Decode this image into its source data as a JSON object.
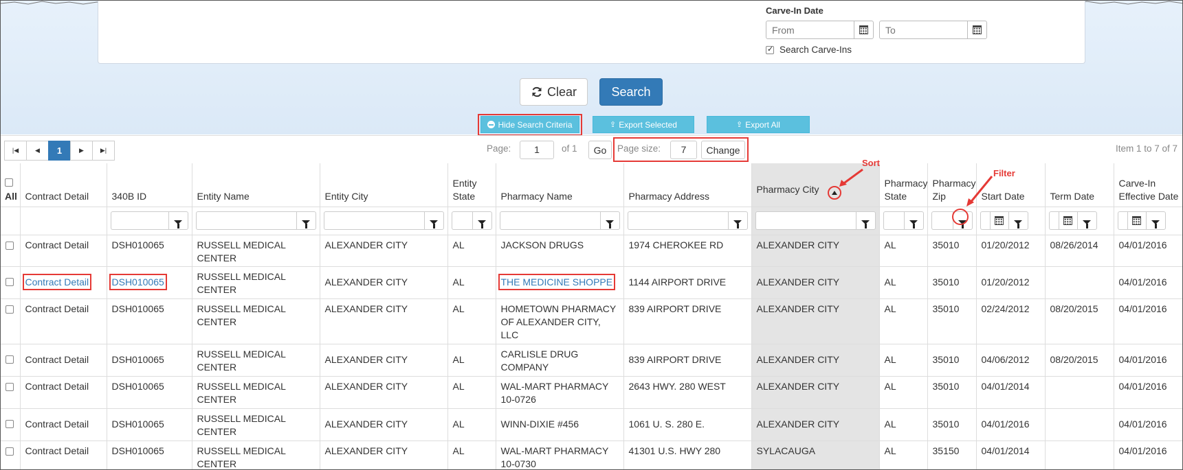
{
  "carve_in": {
    "label": "Carve-In Date",
    "from_placeholder": "From",
    "to_placeholder": "To",
    "search_carve_ins_label": "Search Carve-Ins",
    "search_carve_ins_checked": true
  },
  "buttons": {
    "clear": "Clear",
    "search": "Search",
    "hide_criteria": "Hide Search Criteria",
    "export_selected": "Export Selected",
    "export_all": "Export All"
  },
  "pager": {
    "page_label": "Page:",
    "page_value": "1",
    "of_text": "of 1",
    "go": "Go",
    "size_label": "Page size:",
    "size_value": "7",
    "change": "Change",
    "current_page": "1",
    "item_summary": "Item 1 to 7 of 7"
  },
  "annotations": {
    "sort": "Sort",
    "filter": "Filter"
  },
  "columns": {
    "all": "All",
    "contract_detail": "Contract Detail",
    "id_340b": "340B ID",
    "entity_name": "Entity Name",
    "entity_city": "Entity City",
    "entity_state": "Entity State",
    "pharmacy_name": "Pharmacy Name",
    "pharmacy_address": "Pharmacy Address",
    "pharmacy_city": "Pharmacy City",
    "pharmacy_state": "Pharmacy State",
    "pharmacy_zip": "Pharmacy Zip",
    "start_date": "Start Date",
    "term_date": "Term Date",
    "carve_in_effective": "Carve-In Effective Date"
  },
  "rows": [
    {
      "contract": "Contract Detail",
      "id": "DSH010065",
      "entity_name": "RUSSELL MEDICAL CENTER",
      "entity_city": "ALEXANDER CITY",
      "entity_state": "AL",
      "pharmacy_name": "JACKSON DRUGS",
      "address": "1974 CHEROKEE RD",
      "pharmacy_city": "ALEXANDER CITY",
      "pharmacy_state": "AL",
      "zip": "35010",
      "start": "01/20/2012",
      "term": "08/26/2014",
      "carve_in": "04/01/2016"
    },
    {
      "contract": "Contract Detail",
      "id": "DSH010065",
      "entity_name": "RUSSELL MEDICAL CENTER",
      "entity_city": "ALEXANDER CITY",
      "entity_state": "AL",
      "pharmacy_name": "THE MEDICINE SHOPPE",
      "address": "1144 AIRPORT DRIVE",
      "pharmacy_city": "ALEXANDER CITY",
      "pharmacy_state": "AL",
      "zip": "35010",
      "start": "01/20/2012",
      "term": "",
      "carve_in": "04/01/2016"
    },
    {
      "contract": "Contract Detail",
      "id": "DSH010065",
      "entity_name": "RUSSELL MEDICAL CENTER",
      "entity_city": "ALEXANDER CITY",
      "entity_state": "AL",
      "pharmacy_name": "HOMETOWN PHARMACY OF ALEXANDER CITY, LLC",
      "address": "839 AIRPORT DRIVE",
      "pharmacy_city": "ALEXANDER CITY",
      "pharmacy_state": "AL",
      "zip": "35010",
      "start": "02/24/2012",
      "term": "08/20/2015",
      "carve_in": "04/01/2016"
    },
    {
      "contract": "Contract Detail",
      "id": "DSH010065",
      "entity_name": "RUSSELL MEDICAL CENTER",
      "entity_city": "ALEXANDER CITY",
      "entity_state": "AL",
      "pharmacy_name": "CARLISLE DRUG COMPANY",
      "address": "839 AIRPORT DRIVE",
      "pharmacy_city": "ALEXANDER CITY",
      "pharmacy_state": "AL",
      "zip": "35010",
      "start": "04/06/2012",
      "term": "08/20/2015",
      "carve_in": "04/01/2016"
    },
    {
      "contract": "Contract Detail",
      "id": "DSH010065",
      "entity_name": "RUSSELL MEDICAL CENTER",
      "entity_city": "ALEXANDER CITY",
      "entity_state": "AL",
      "pharmacy_name": "WAL-MART PHARMACY 10-0726",
      "address": "2643 HWY. 280 WEST",
      "pharmacy_city": "ALEXANDER CITY",
      "pharmacy_state": "AL",
      "zip": "35010",
      "start": "04/01/2014",
      "term": "",
      "carve_in": "04/01/2016"
    },
    {
      "contract": "Contract Detail",
      "id": "DSH010065",
      "entity_name": "RUSSELL MEDICAL CENTER",
      "entity_city": "ALEXANDER CITY",
      "entity_state": "AL",
      "pharmacy_name": "WINN-DIXIE #456",
      "address": "1061 U. S. 280 E.",
      "pharmacy_city": "ALEXANDER CITY",
      "pharmacy_state": "AL",
      "zip": "35010",
      "start": "04/01/2016",
      "term": "",
      "carve_in": "04/01/2016"
    },
    {
      "contract": "Contract Detail",
      "id": "DSH010065",
      "entity_name": "RUSSELL MEDICAL CENTER",
      "entity_city": "ALEXANDER CITY",
      "entity_state": "AL",
      "pharmacy_name": "WAL-MART PHARMACY 10-0730",
      "address": "41301 U.S. HWY 280",
      "pharmacy_city": "SYLACAUGA",
      "pharmacy_state": "AL",
      "zip": "35150",
      "start": "04/01/2014",
      "term": "",
      "carve_in": "04/01/2016"
    }
  ],
  "colors": {
    "primary": "#337ab7",
    "info": "#5bc0de",
    "highlight": "#e53935",
    "sorted_column_bg": "#e4e4e4"
  }
}
